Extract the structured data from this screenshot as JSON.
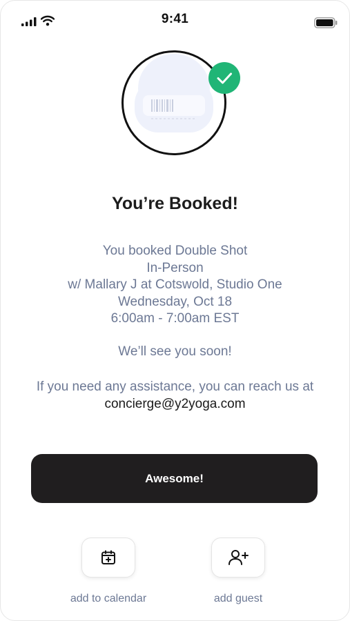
{
  "status_bar": {
    "time": "9:41"
  },
  "icons": {
    "signal": "signal-bars-icon",
    "wifi": "wifi-icon",
    "battery": "battery-icon",
    "check": "checkmark-icon",
    "calendar": "calendar-add-icon",
    "guest": "add-user-icon"
  },
  "booking": {
    "title": "You’re Booked!",
    "lines": [
      "You booked Double Shot",
      "In-Person",
      "w/ Mallary J at Cotswold, Studio One",
      "Wednesday, Oct 18",
      "6:00am - 7:00am EST"
    ],
    "see_you": "We’ll see you soon!",
    "assist_text": "If you need any assistance, you can reach us at",
    "email": "concierge@y2yoga.com"
  },
  "primary_button": {
    "label": "Awesome!"
  },
  "actions": {
    "calendar_label": "add to calendar",
    "guest_label": "add guest"
  },
  "colors": {
    "accent_green": "#20b576",
    "button_dark": "#201e1f",
    "muted_text": "#6c7894"
  }
}
